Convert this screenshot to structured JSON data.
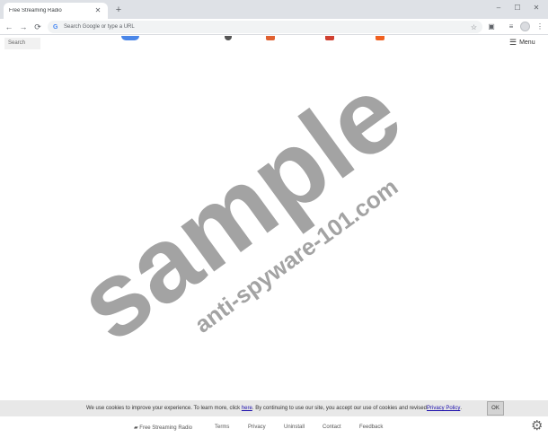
{
  "browser": {
    "tab_title": "Free Streaming Radio",
    "tab_close": "✕",
    "new_tab": "+",
    "window_controls": {
      "minimize": "–",
      "maximize": "☐",
      "close": "✕"
    },
    "nav": {
      "back": "←",
      "forward": "→",
      "reload": "⟳"
    },
    "omnibox_placeholder": "Search Google or type a URL",
    "omnibox_icon": "G"
  },
  "page": {
    "search_placeholder": "Search",
    "menu_label": "Menu",
    "tile_colors": [
      "#4a86e8",
      "#555555",
      "#e06030",
      "#d04030",
      "#f06020"
    ]
  },
  "watermark": {
    "line1": "sample",
    "line2": "anti-spyware-101.com"
  },
  "cookie": {
    "text_before": "We use cookies to improve your experience. To learn more, click ",
    "here_link": "here",
    "text_middle": ". By continuing to use our site, you accept our use of cookies and revised ",
    "policy_link": "Privacy Policy",
    "text_after": ".",
    "ok_label": "OK"
  },
  "footer": {
    "brand": "Free Streaming Radio",
    "links": [
      "Terms",
      "Privacy",
      "Uninstall",
      "Contact",
      "Feedback"
    ]
  }
}
